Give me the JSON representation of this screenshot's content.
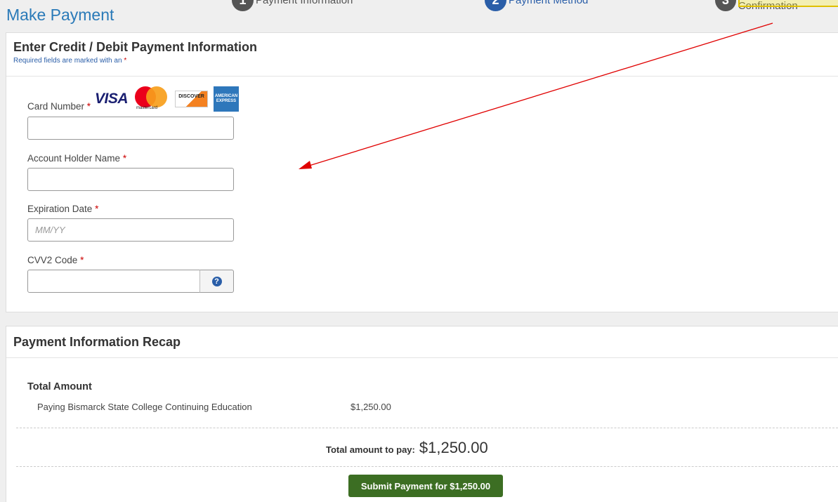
{
  "header": {
    "title": "Make Payment",
    "steps": [
      {
        "num": "1",
        "label": "Payment Information"
      },
      {
        "num": "2",
        "label": "Payment Method"
      },
      {
        "num": "3",
        "label": "Payment Confirmation"
      }
    ]
  },
  "card_form": {
    "title": "Enter Credit / Debit Payment Information",
    "required_note": "Required fields are marked with an",
    "required_marker": "*",
    "card_number_label": "Card Number",
    "card_number_value": "",
    "card_brands": [
      "VISA",
      "mastercard",
      "DISCOVER",
      "AMERICAN EXPRESS"
    ],
    "account_holder_label": "Account Holder Name",
    "account_holder_value": "",
    "expiration_label": "Expiration Date",
    "expiration_placeholder": "MM/YY",
    "cvv_label": "CVV2 Code",
    "cvv_value": "",
    "cvv_help_icon": "question-circle-icon"
  },
  "recap": {
    "title": "Payment Information Recap",
    "total_heading": "Total Amount",
    "line_description": "Paying Bismarck State College Continuing Education",
    "line_amount": "$1,250.00",
    "total_label": "Total amount to pay:",
    "total_value": "$1,250.00",
    "submit_label": "Submit Payment for $1,250.00"
  },
  "colors": {
    "title_blue": "#2a7ab8",
    "active_step": "#2a5ea8",
    "submit_green": "#3c6e23",
    "required_red": "#cc0000",
    "annotation_arrow": "#e00000"
  }
}
